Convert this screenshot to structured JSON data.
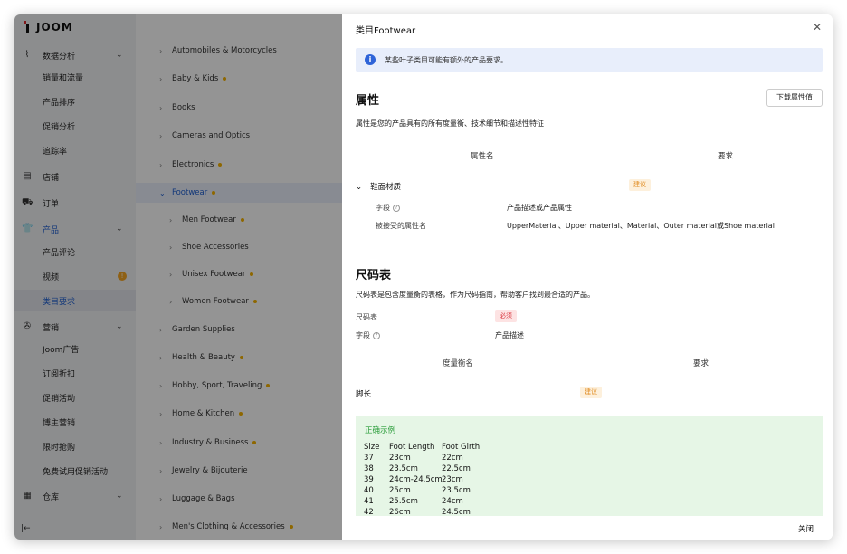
{
  "app": {
    "logo": "JOOM"
  },
  "sidebar": {
    "items": [
      {
        "icon": "analytics-icon",
        "label": "数据分析",
        "chevron": true,
        "group": true
      },
      {
        "label": "销量和流量",
        "sub": true
      },
      {
        "label": "产品排序",
        "sub": true
      },
      {
        "label": "促销分析",
        "sub": true
      },
      {
        "label": "追踪率",
        "sub": true
      },
      {
        "icon": "store-icon",
        "label": "店铺",
        "group": true
      },
      {
        "icon": "cart-icon",
        "label": "订单",
        "group": true
      },
      {
        "icon": "shirt-icon",
        "label": "产品",
        "chevron": true,
        "group": true,
        "active": true
      },
      {
        "label": "产品评论",
        "sub": true
      },
      {
        "label": "视频",
        "sub": true,
        "badge": "!"
      },
      {
        "label": "类目要求",
        "sub": true,
        "selected": true
      },
      {
        "icon": "megaphone-icon",
        "label": "营销",
        "chevron": true,
        "group": true
      },
      {
        "label": "Joom广告",
        "sub": true
      },
      {
        "label": "订阅折扣",
        "sub": true
      },
      {
        "label": "促销活动",
        "sub": true
      },
      {
        "label": "博主营销",
        "sub": true
      },
      {
        "label": "限时抢购",
        "sub": true
      },
      {
        "label": "免费试用促销活动",
        "sub": true
      },
      {
        "icon": "warehouse-icon",
        "label": "仓库",
        "chevron": true,
        "group": true
      }
    ]
  },
  "tree": {
    "rows": [
      {
        "label": "Automobiles & Motorcycles",
        "dot": false
      },
      {
        "label": "Baby & Kids",
        "dot": true
      },
      {
        "label": "Books",
        "dot": false
      },
      {
        "label": "Cameras and Optics",
        "dot": false
      },
      {
        "label": "Electronics",
        "dot": true
      },
      {
        "label": "Footwear",
        "dot": true,
        "expanded": true,
        "selected": true
      },
      {
        "label": "Men Footwear",
        "dot": true,
        "child": true
      },
      {
        "label": "Shoe Accessories",
        "dot": false,
        "child": true
      },
      {
        "label": "Unisex Footwear",
        "dot": true,
        "child": true
      },
      {
        "label": "Women Footwear",
        "dot": true,
        "child": true
      },
      {
        "label": "Garden Supplies",
        "dot": false
      },
      {
        "label": "Health & Beauty",
        "dot": true
      },
      {
        "label": "Hobby, Sport, Traveling",
        "dot": true
      },
      {
        "label": "Home & Kitchen",
        "dot": true
      },
      {
        "label": "Industry & Business",
        "dot": true
      },
      {
        "label": "Jewelry & Bijouterie",
        "dot": false
      },
      {
        "label": "Luggage & Bags",
        "dot": false
      },
      {
        "label": "Men's Clothing & Accessories",
        "dot": true
      }
    ]
  },
  "drawer": {
    "title": "类目Footwear",
    "info": "某些叶子类目可能有额外的产品要求。",
    "attributes": {
      "title": "属性",
      "download_button": "下载属性值",
      "desc": "属性是您的产品具有的所有度量衡、技术细节和描述性特征",
      "col_name": "属性名",
      "col_req": "要求",
      "row_name": "鞋面材质",
      "row_tag": "建议",
      "field_label": "字段",
      "field_value": "产品描述或产品属性",
      "accepted_label": "被接受的属性名",
      "accepted_value": "UpperMaterial、Upper material、Material、Outer material或Shoe material"
    },
    "size_chart": {
      "title": "尺码表",
      "desc": "尺码表是包含度量衡的表格，作为尺码指南，帮助客户找到最合适的产品。",
      "chart_label": "尺码表",
      "chart_tag": "必须",
      "field_label": "字段",
      "field_value": "产品描述",
      "col_name": "度量衡名",
      "col_req": "要求",
      "row_name": "脚长",
      "row_tag": "建议"
    },
    "example": {
      "title": "正确示例",
      "header": [
        "Size",
        "Foot Length",
        "Foot Girth"
      ],
      "rows": [
        [
          "37",
          "23cm",
          "22cm"
        ],
        [
          "38",
          "23.5cm",
          "22.5cm"
        ],
        [
          "39",
          "24cm-24.5cm",
          "23cm"
        ],
        [
          "40",
          "25cm",
          "23.5cm"
        ],
        [
          "41",
          "25.5cm",
          "24cm"
        ],
        [
          "42",
          "26cm",
          "24.5cm"
        ]
      ]
    },
    "close_button": "关闭"
  }
}
